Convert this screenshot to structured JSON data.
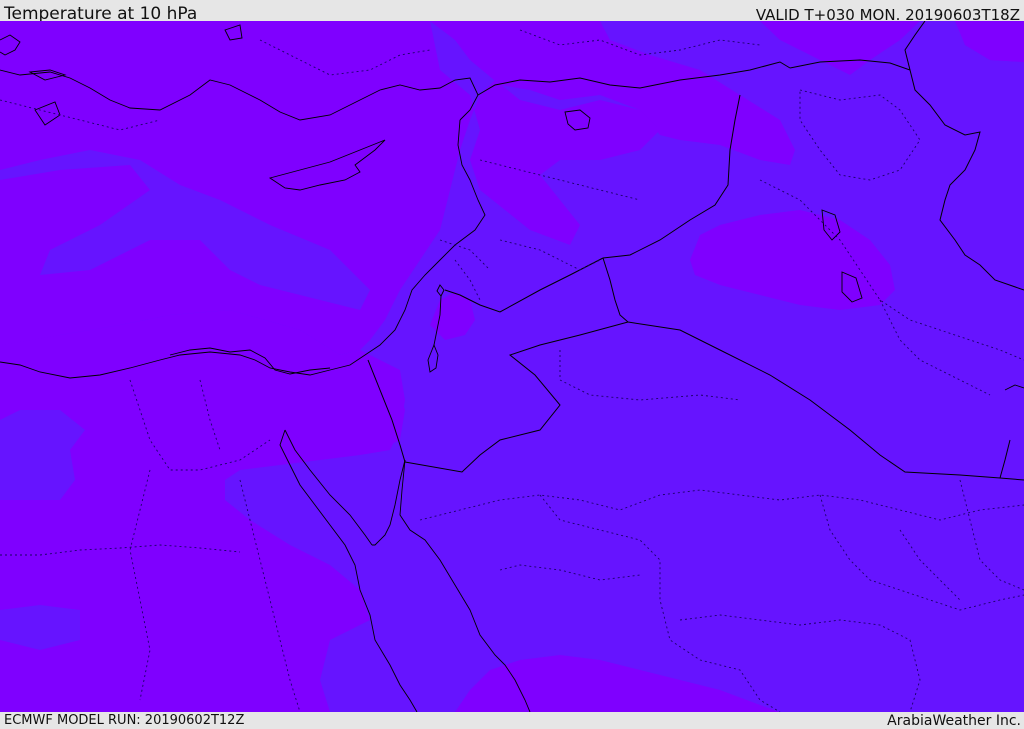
{
  "header": {
    "title": "Temperature at 10 hPa",
    "valid_time": "VALID T+030 MON. 20190603T18Z"
  },
  "footer": {
    "model_run": "ECMWF MODEL RUN: 20190602T12Z",
    "credit": "ArabiaWeather Inc."
  },
  "map": {
    "fill_colors": {
      "warmer_band": "#7f00ff",
      "cooler_band": "#6614ff"
    },
    "boundary_colors": {
      "coastline": "#000000",
      "country_border": "#000000",
      "province_border": "#1a0066"
    }
  }
}
